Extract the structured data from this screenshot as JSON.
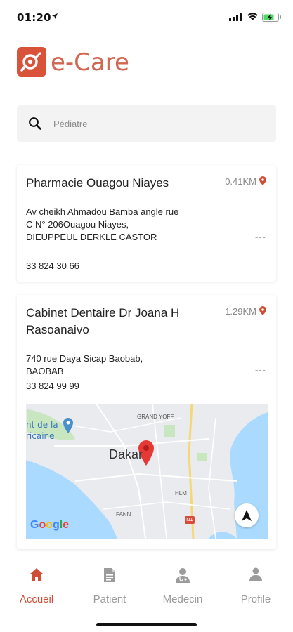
{
  "status_bar": {
    "time": "01:20"
  },
  "app": {
    "logo_text": "e-Care",
    "brand_color": "#cf6752",
    "accent_color": "#d04e36"
  },
  "search": {
    "placeholder": "Pédiatre",
    "icon": "search-icon"
  },
  "results": [
    {
      "name": "Pharmacie Ouagou Niayes",
      "distance": "0.41KM",
      "address": "Av cheikh Ahmadou Bamba angle rue C N° 206Ouagou Niayes, DIEUPPEUL  DERKLE CASTOR",
      "phone": "33 824 30 66",
      "more": "---"
    },
    {
      "name": "Cabinet Dentaire Dr Joana H Rasoanaivo",
      "distance": "1.29KM",
      "address": "740 rue Daya Sicap Baobab, BAOBAB",
      "phone": "33 824 99 99",
      "more": "---"
    }
  ],
  "map": {
    "label_grand_yoff": "GRAND YOFF",
    "label_dakar": "Dakar",
    "label_hlm": "HLM",
    "label_fann": "FANN",
    "label_poi": "nt de la\nricaine",
    "label_road": "N1",
    "attribution": "Google"
  },
  "tabs": [
    {
      "label": "Accueil",
      "icon": "home-icon",
      "active": true
    },
    {
      "label": "Patient",
      "icon": "document-icon",
      "active": false
    },
    {
      "label": "Medecin",
      "icon": "doctor-icon",
      "active": false
    },
    {
      "label": "Profile",
      "icon": "person-icon",
      "active": false
    }
  ]
}
